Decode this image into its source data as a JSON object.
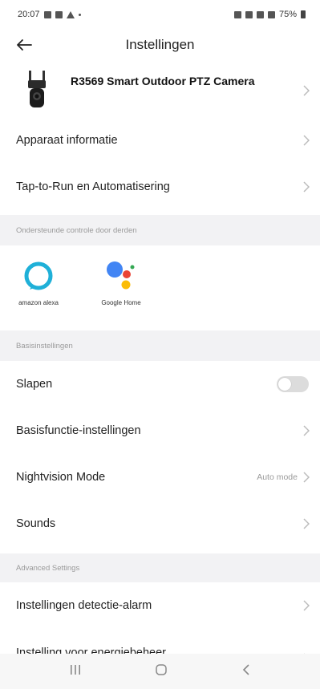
{
  "status_bar": {
    "time": "20:07",
    "battery_text": "75%"
  },
  "header": {
    "title": "Instellingen"
  },
  "device": {
    "name": "R3569 Smart Outdoor PTZ Camera"
  },
  "rows_top": [
    {
      "label": "Apparaat informatie"
    },
    {
      "label": "Tap-to-Run en Automatisering"
    }
  ],
  "sections": {
    "third_party": "Ondersteunde controle door derden",
    "basic": "Basisinstellingen",
    "advanced": "Advanced Settings"
  },
  "third_party": {
    "alexa_label": "amazon alexa",
    "google_label": "Google Home"
  },
  "basic_rows": {
    "sleep": "Slapen",
    "basic_functions": "Basisfunctie-instellingen",
    "nightvision": "Nightvision Mode",
    "nightvision_value": "Auto mode",
    "sounds": "Sounds"
  },
  "advanced_rows": {
    "detection_alarm": "Instellingen detectie-alarm",
    "energy": "Instelling voor energiebeheer"
  },
  "toggle": {
    "sleep_on": false
  },
  "colors": {
    "section_bg": "#f2f2f4",
    "alexa": "#1fb0d8"
  }
}
